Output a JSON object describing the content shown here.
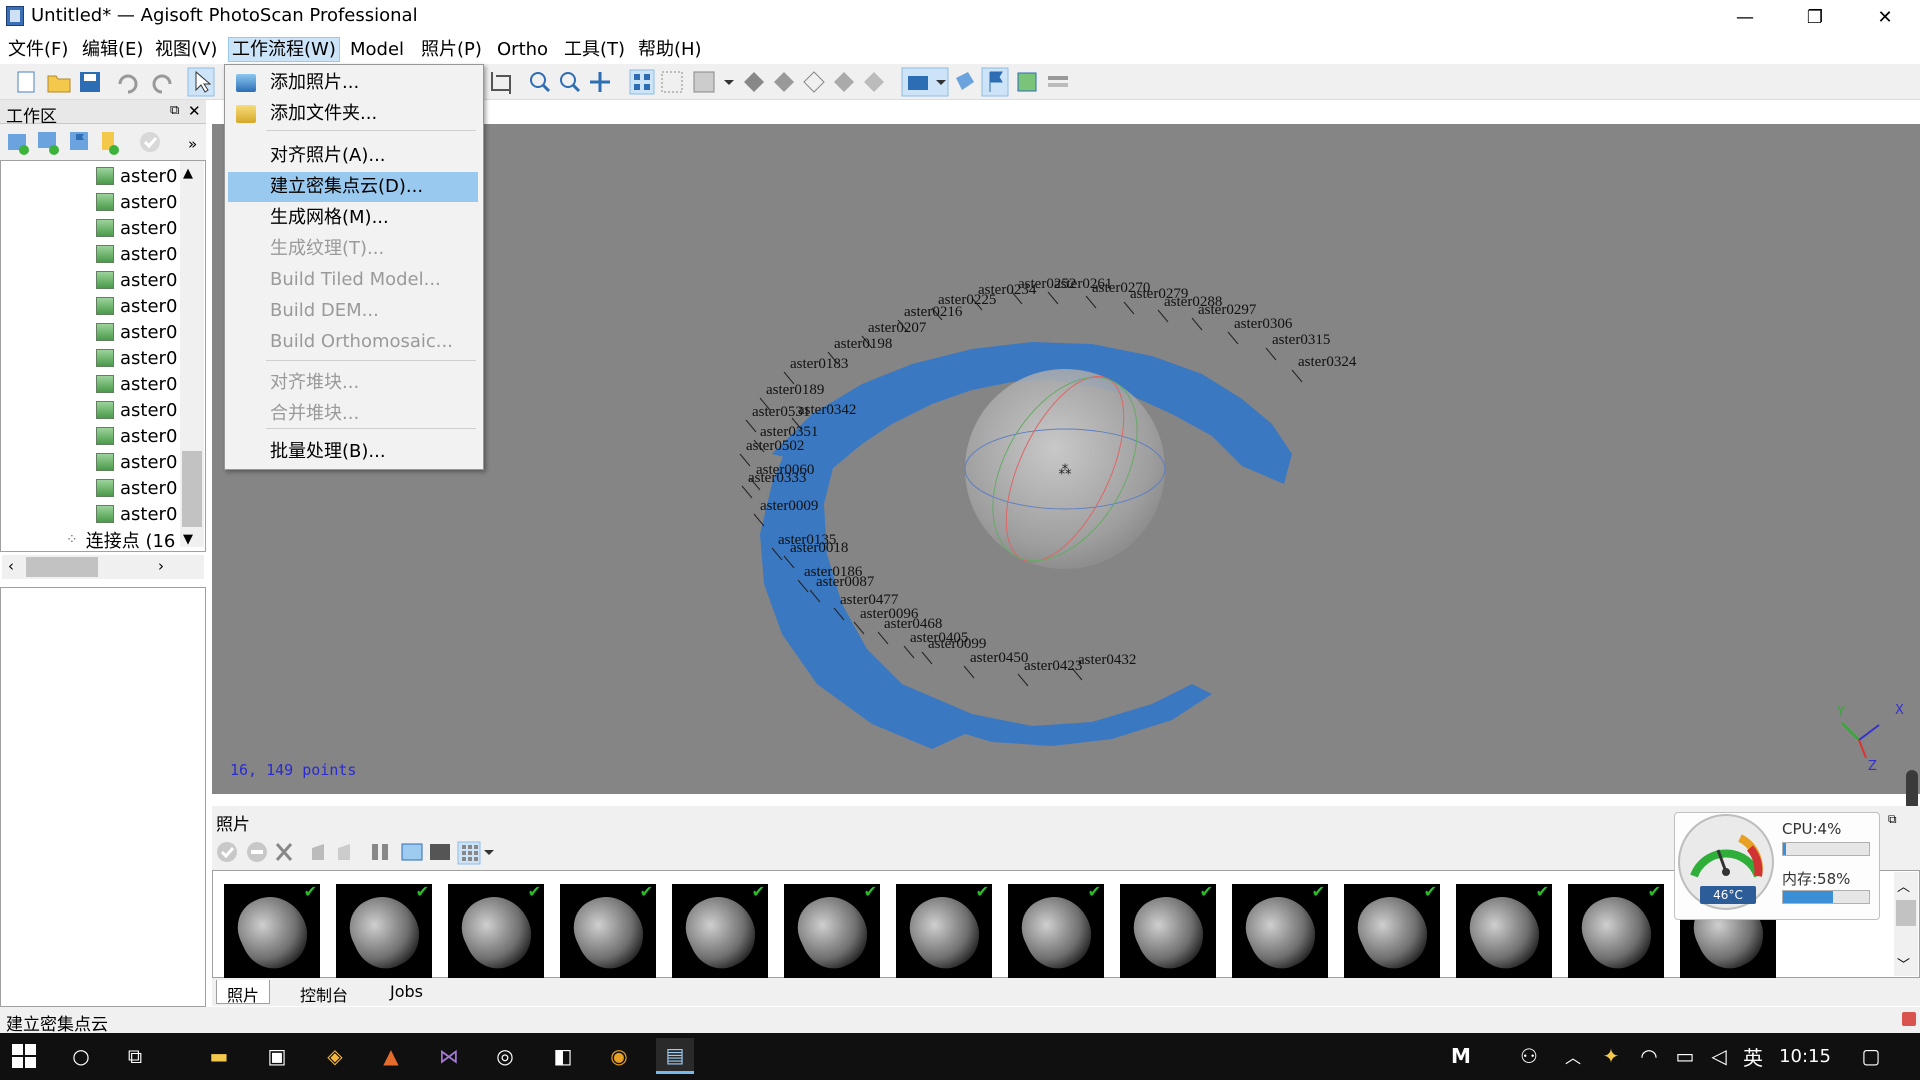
{
  "window": {
    "title": "Untitled* — Agisoft PhotoScan Professional",
    "controls": {
      "minimize": "—",
      "maximize": "❐",
      "close": "✕"
    }
  },
  "menubar": {
    "items": [
      "文件(F)",
      "编辑(E)",
      "视图(V)",
      "工作流程(W)",
      "Model",
      "照片(P)",
      "Ortho",
      "工具(T)",
      "帮助(H)"
    ],
    "active_index": 3
  },
  "workflow_menu": {
    "items": [
      {
        "label": "添加照片...",
        "enabled": true,
        "icon": "add-photos-icon"
      },
      {
        "label": "添加文件夹...",
        "enabled": true,
        "icon": "add-folder-icon"
      },
      {
        "label": "对齐照片(A)...",
        "enabled": true
      },
      {
        "label": "建立密集点云(D)...",
        "enabled": true,
        "highlighted": true
      },
      {
        "label": "生成网格(M)...",
        "enabled": true
      },
      {
        "label": "生成纹理(T)...",
        "enabled": false
      },
      {
        "label": "Build Tiled Model...",
        "enabled": false
      },
      {
        "label": "Build DEM...",
        "enabled": false
      },
      {
        "label": "Build Orthomosaic...",
        "enabled": false
      },
      {
        "label": "对齐堆块...",
        "enabled": false
      },
      {
        "label": "合并堆块...",
        "enabled": false
      },
      {
        "label": "批量处理(B)...",
        "enabled": true
      }
    ]
  },
  "workspace": {
    "title": "工作区",
    "expand_glyph": "»",
    "items": [
      "aster0",
      "aster0",
      "aster0",
      "aster0",
      "aster0",
      "aster0",
      "aster0",
      "aster0",
      "aster0",
      "aster0",
      "aster0",
      "aster0",
      "aster0",
      "aster0"
    ],
    "tie_points": "连接点 (16"
  },
  "viewport": {
    "points_label": "16, 149 points",
    "axis": {
      "x": "X",
      "y": "Y",
      "z": "Z"
    },
    "camera_labels": [
      "aster0252",
      "aster0261",
      "aster0270",
      "aster0279",
      "aster0288",
      "aster0297",
      "aster0306",
      "aster0315",
      "aster0324",
      "aster0234",
      "aster0225",
      "aster0216",
      "aster0207",
      "aster0198",
      "aster0183",
      "aster0189",
      "aster0342",
      "aster0531",
      "aster0351",
      "aster0502",
      "aster0060",
      "aster0333",
      "aster0009",
      "aster0135",
      "aster0018",
      "aster0186",
      "aster0087",
      "aster0477",
      "aster0096",
      "aster0468",
      "aster0405",
      "aster0099",
      "aster0450",
      "aster0423",
      "aster0432"
    ],
    "background": "#858585",
    "cloud_color": "#3b78c2"
  },
  "photos_panel": {
    "title": "照片",
    "thumbnail_count": 14,
    "tabs": [
      "照片",
      "控制台",
      "Jobs"
    ],
    "active_tab": 0
  },
  "status_bar": {
    "text": "建立密集点云"
  },
  "system_monitor": {
    "cpu": "CPU:4%",
    "cpu_fraction": 0.04,
    "memory": "内存:58%",
    "memory_fraction": 0.58,
    "temperature": "46°C"
  },
  "taskbar": {
    "ime_mode": "M",
    "language": "英",
    "time": "10:15"
  }
}
